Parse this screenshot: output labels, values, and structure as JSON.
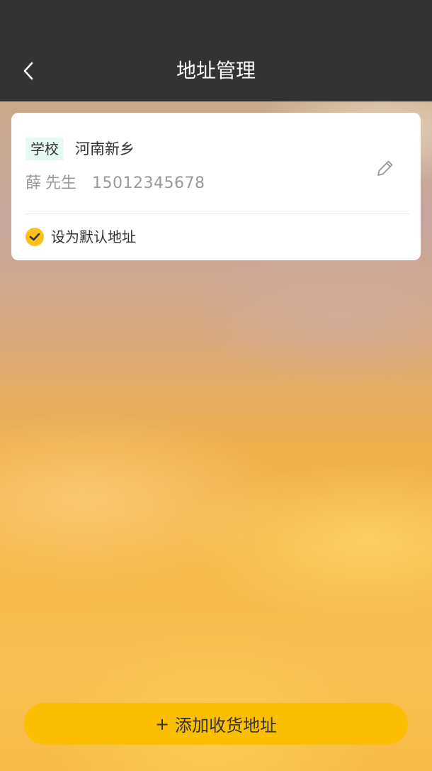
{
  "header": {
    "title": "地址管理",
    "back_icon": "chevron-left-icon"
  },
  "address_card": {
    "tag": "学校",
    "address": "河南新乡",
    "contact_name": "薛",
    "contact_title": "先生",
    "phone": "15012345678",
    "edit_icon": "pencil-icon",
    "default_label": "设为默认地址",
    "default_checked": true
  },
  "footer": {
    "add_plus": "+",
    "add_label": "添加收货地址"
  },
  "colors": {
    "header_bg": "#333333",
    "accent": "#fcbf00",
    "tag_bg": "#e6f9f5",
    "text_primary": "#333333",
    "text_secondary": "#999999"
  }
}
